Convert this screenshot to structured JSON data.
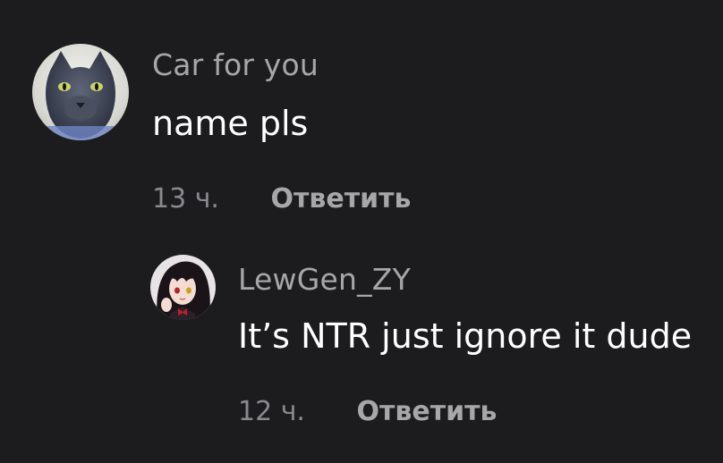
{
  "comments": [
    {
      "username": "Car for you",
      "text": "name pls",
      "time": "13 ч.",
      "reply_label": "Ответить",
      "avatar_icon": "black-cat-avatar"
    },
    {
      "username": "LewGen_ZY",
      "text": "It’s NTR just ignore it dude",
      "time": "12 ч.",
      "reply_label": "Ответить",
      "avatar_icon": "anime-girl-avatar"
    }
  ],
  "colors": {
    "background": "#1c1c1e",
    "username": "#a7a7aa",
    "text": "#ffffff",
    "time": "#8a8a8e"
  }
}
